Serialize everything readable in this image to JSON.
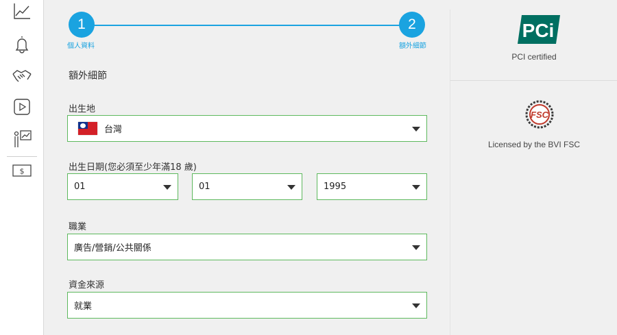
{
  "stepper": {
    "steps": [
      {
        "number": "1",
        "label": "個人資料"
      },
      {
        "number": "2",
        "label": "額外細節"
      }
    ]
  },
  "form": {
    "section_title": "額外細節",
    "birthplace": {
      "label": "出生地",
      "value": "台灣"
    },
    "dob": {
      "label": "出生日期(您必須至少年滿18 歲)",
      "day": "01",
      "month": "01",
      "year": "1995"
    },
    "occupation": {
      "label": "職業",
      "value": "廣告/營銷/公共關係"
    },
    "source_of_funds": {
      "label": "資金來源",
      "value": "就業"
    }
  },
  "side": {
    "pci_text": "PCI certified",
    "fsc_text": "Licensed by the BVI FSC",
    "pci_logo_text": "PCi",
    "fsc_logo_text": "FSC"
  },
  "colors": {
    "accent": "#1aa3e0",
    "field_border": "#5cb85c",
    "pci_green": "#006f61",
    "fsc_red": "#c0392b"
  },
  "rail": {
    "icons": [
      "chart-line-icon",
      "bell-icon",
      "handshake-icon",
      "play-icon",
      "presenter-chart-icon",
      "dollar-bill-icon"
    ]
  }
}
